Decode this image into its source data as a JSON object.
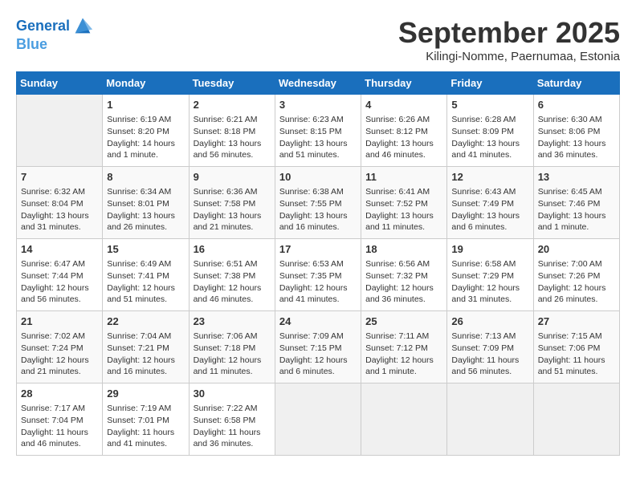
{
  "header": {
    "logo_line1": "General",
    "logo_line2": "Blue",
    "month_year": "September 2025",
    "location": "Kilingi-Nomme, Paernumaa, Estonia"
  },
  "days_of_week": [
    "Sunday",
    "Monday",
    "Tuesday",
    "Wednesday",
    "Thursday",
    "Friday",
    "Saturday"
  ],
  "weeks": [
    [
      {
        "day": "",
        "info": ""
      },
      {
        "day": "1",
        "info": "Sunrise: 6:19 AM\nSunset: 8:20 PM\nDaylight: 14 hours\nand 1 minute."
      },
      {
        "day": "2",
        "info": "Sunrise: 6:21 AM\nSunset: 8:18 PM\nDaylight: 13 hours\nand 56 minutes."
      },
      {
        "day": "3",
        "info": "Sunrise: 6:23 AM\nSunset: 8:15 PM\nDaylight: 13 hours\nand 51 minutes."
      },
      {
        "day": "4",
        "info": "Sunrise: 6:26 AM\nSunset: 8:12 PM\nDaylight: 13 hours\nand 46 minutes."
      },
      {
        "day": "5",
        "info": "Sunrise: 6:28 AM\nSunset: 8:09 PM\nDaylight: 13 hours\nand 41 minutes."
      },
      {
        "day": "6",
        "info": "Sunrise: 6:30 AM\nSunset: 8:06 PM\nDaylight: 13 hours\nand 36 minutes."
      }
    ],
    [
      {
        "day": "7",
        "info": "Sunrise: 6:32 AM\nSunset: 8:04 PM\nDaylight: 13 hours\nand 31 minutes."
      },
      {
        "day": "8",
        "info": "Sunrise: 6:34 AM\nSunset: 8:01 PM\nDaylight: 13 hours\nand 26 minutes."
      },
      {
        "day": "9",
        "info": "Sunrise: 6:36 AM\nSunset: 7:58 PM\nDaylight: 13 hours\nand 21 minutes."
      },
      {
        "day": "10",
        "info": "Sunrise: 6:38 AM\nSunset: 7:55 PM\nDaylight: 13 hours\nand 16 minutes."
      },
      {
        "day": "11",
        "info": "Sunrise: 6:41 AM\nSunset: 7:52 PM\nDaylight: 13 hours\nand 11 minutes."
      },
      {
        "day": "12",
        "info": "Sunrise: 6:43 AM\nSunset: 7:49 PM\nDaylight: 13 hours\nand 6 minutes."
      },
      {
        "day": "13",
        "info": "Sunrise: 6:45 AM\nSunset: 7:46 PM\nDaylight: 13 hours\nand 1 minute."
      }
    ],
    [
      {
        "day": "14",
        "info": "Sunrise: 6:47 AM\nSunset: 7:44 PM\nDaylight: 12 hours\nand 56 minutes."
      },
      {
        "day": "15",
        "info": "Sunrise: 6:49 AM\nSunset: 7:41 PM\nDaylight: 12 hours\nand 51 minutes."
      },
      {
        "day": "16",
        "info": "Sunrise: 6:51 AM\nSunset: 7:38 PM\nDaylight: 12 hours\nand 46 minutes."
      },
      {
        "day": "17",
        "info": "Sunrise: 6:53 AM\nSunset: 7:35 PM\nDaylight: 12 hours\nand 41 minutes."
      },
      {
        "day": "18",
        "info": "Sunrise: 6:56 AM\nSunset: 7:32 PM\nDaylight: 12 hours\nand 36 minutes."
      },
      {
        "day": "19",
        "info": "Sunrise: 6:58 AM\nSunset: 7:29 PM\nDaylight: 12 hours\nand 31 minutes."
      },
      {
        "day": "20",
        "info": "Sunrise: 7:00 AM\nSunset: 7:26 PM\nDaylight: 12 hours\nand 26 minutes."
      }
    ],
    [
      {
        "day": "21",
        "info": "Sunrise: 7:02 AM\nSunset: 7:24 PM\nDaylight: 12 hours\nand 21 minutes."
      },
      {
        "day": "22",
        "info": "Sunrise: 7:04 AM\nSunset: 7:21 PM\nDaylight: 12 hours\nand 16 minutes."
      },
      {
        "day": "23",
        "info": "Sunrise: 7:06 AM\nSunset: 7:18 PM\nDaylight: 12 hours\nand 11 minutes."
      },
      {
        "day": "24",
        "info": "Sunrise: 7:09 AM\nSunset: 7:15 PM\nDaylight: 12 hours\nand 6 minutes."
      },
      {
        "day": "25",
        "info": "Sunrise: 7:11 AM\nSunset: 7:12 PM\nDaylight: 12 hours\nand 1 minute."
      },
      {
        "day": "26",
        "info": "Sunrise: 7:13 AM\nSunset: 7:09 PM\nDaylight: 11 hours\nand 56 minutes."
      },
      {
        "day": "27",
        "info": "Sunrise: 7:15 AM\nSunset: 7:06 PM\nDaylight: 11 hours\nand 51 minutes."
      }
    ],
    [
      {
        "day": "28",
        "info": "Sunrise: 7:17 AM\nSunset: 7:04 PM\nDaylight: 11 hours\nand 46 minutes."
      },
      {
        "day": "29",
        "info": "Sunrise: 7:19 AM\nSunset: 7:01 PM\nDaylight: 11 hours\nand 41 minutes."
      },
      {
        "day": "30",
        "info": "Sunrise: 7:22 AM\nSunset: 6:58 PM\nDaylight: 11 hours\nand 36 minutes."
      },
      {
        "day": "",
        "info": ""
      },
      {
        "day": "",
        "info": ""
      },
      {
        "day": "",
        "info": ""
      },
      {
        "day": "",
        "info": ""
      }
    ]
  ]
}
